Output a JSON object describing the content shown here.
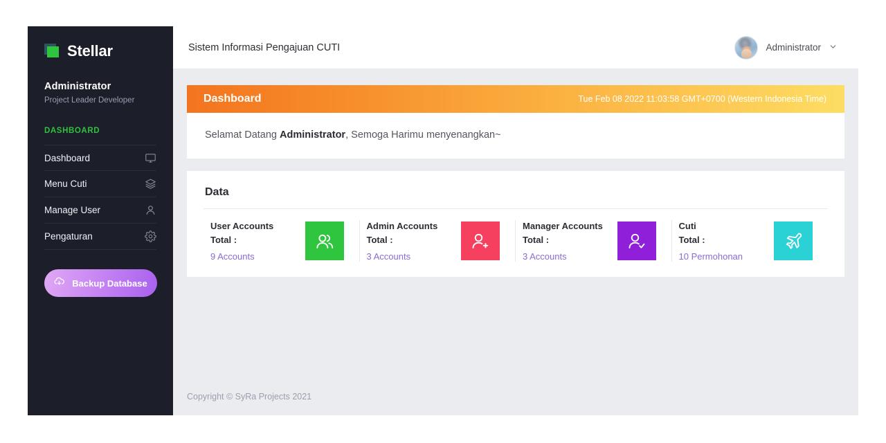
{
  "sidebar": {
    "brand": {
      "name": "Stellar",
      "logo_icon": "stellar-squares-logo"
    },
    "user": {
      "name": "Administrator",
      "role": "Project Leader Developer"
    },
    "section_label": "DASHBOARD",
    "items": [
      {
        "label": "Dashboard",
        "icon": "monitor-icon"
      },
      {
        "label": "Menu Cuti",
        "icon": "layers-icon"
      },
      {
        "label": "Manage User",
        "icon": "user-icon"
      },
      {
        "label": "Pengaturan",
        "icon": "gear-icon"
      }
    ],
    "backup_button": {
      "label": "Backup Database",
      "icon": "cloud-download-icon"
    },
    "colors": {
      "background": "#1c1e2a",
      "accent": "#2fc23f",
      "divider": "#2c2e3c"
    }
  },
  "topbar": {
    "title": "Sistem Informasi Pengajuan CUTI",
    "username": "Administrator",
    "caret_icon": "chevron-down-icon",
    "avatar_icon": "user-avatar-photo"
  },
  "banner": {
    "title": "Dashboard",
    "datetime": "Tue Feb 08 2022 11:03:58 GMT+0700 (Western Indonesia Time)",
    "gradient_from": "#f4741f",
    "gradient_to": "#fddd63"
  },
  "welcome": {
    "prefix": "Selamat Datang ",
    "name": "Administrator",
    "suffix": ", Semoga Harimu menyenangkan~"
  },
  "data_panel": {
    "title": "Data",
    "stats": [
      {
        "label": "User Accounts\nTotal :",
        "label_line1": "User Accounts",
        "label_line2": "Total :",
        "value": "9 Accounts",
        "icon": "users-group-icon",
        "color": "#30c53f"
      },
      {
        "label_line1": "Admin Accounts",
        "label_line2": "Total :",
        "value": "3 Accounts",
        "icon": "user-add-icon",
        "color": "#f6405f"
      },
      {
        "label_line1": "Manager Accounts",
        "label_line2": "Total :",
        "value": "3 Accounts",
        "icon": "user-check-icon",
        "color": "#8f1fd8"
      },
      {
        "label_line1": "Cuti",
        "label_line2": "Total :",
        "value": "10 Permohonan",
        "icon": "airplane-icon",
        "color": "#2ad2d6"
      }
    ]
  },
  "footer": {
    "text": "Copyright © SyRa Projects 2021"
  }
}
